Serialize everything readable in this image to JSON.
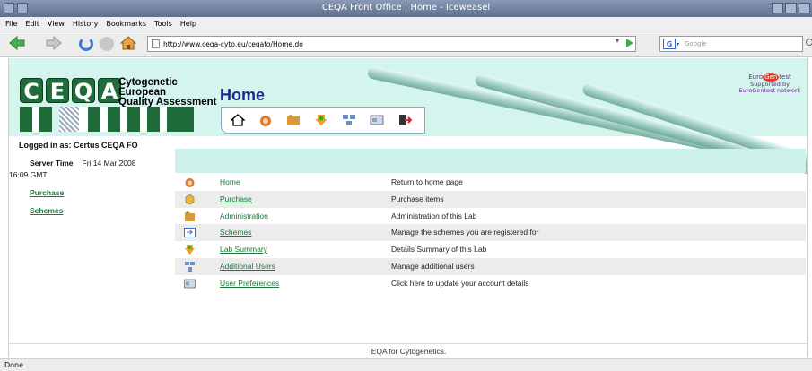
{
  "window": {
    "title": "CEQA Front Office | Home - Iceweasel"
  },
  "menu": [
    "File",
    "Edit",
    "View",
    "History",
    "Bookmarks",
    "Tools",
    "Help"
  ],
  "nav": {
    "url": "http://www.ceqa-cyto.eu/ceqafo/Home.do",
    "search_placeholder": "Google"
  },
  "logo": {
    "letters": [
      "C",
      "E",
      "Q",
      "A"
    ],
    "tagline_line1": "Cytogenetic European",
    "tagline_line2": "Quality Assessment"
  },
  "page_title": "Home",
  "toolbar_icons": [
    "home-icon",
    "purchase-icon",
    "administration-icon",
    "lab-summary-icon",
    "additional-users-icon",
    "user-preferences-icon",
    "logout-icon"
  ],
  "eurogentest": {
    "brand_pre": "Euro",
    "brand_mid": "Gen",
    "brand_post": "test",
    "line1": "Supported by",
    "line2": "EuroGentest network"
  },
  "sidebar": {
    "logged_in": "Logged in as: Certus CEQA FO",
    "server_time_label": "Server Time",
    "server_time_value": "Fri 14 Mar 2008",
    "server_time_cont": "16:09 GMT",
    "links": [
      "Purchase",
      "Schemes"
    ]
  },
  "menu_rows": [
    {
      "icon": "home-icon",
      "link": "Home",
      "desc": "Return to home page"
    },
    {
      "icon": "purchase-icon",
      "link": "Purchase",
      "desc": "Purchase items"
    },
    {
      "icon": "administration-icon",
      "link": "Administration",
      "desc": "Administration of this Lab"
    },
    {
      "icon": "schemes-icon",
      "link": "Schemes",
      "desc": "Manage the schemes you are registered for"
    },
    {
      "icon": "lab-summary-icon",
      "link": "Lab Summary",
      "desc": "Details Summary of this Lab"
    },
    {
      "icon": "additional-users-icon",
      "link": "Additional Users",
      "desc": "Manage additional users"
    },
    {
      "icon": "user-preferences-icon",
      "link": "User Preferences",
      "desc": "Click here to update your account details"
    }
  ],
  "footer": "EQA for Cytogenetics.",
  "status": "Done",
  "colors": {
    "header_bg": "#d4f4ee",
    "link": "#1a7a3a",
    "title": "#1a2a8a",
    "logo_green": "#1f6b3a"
  }
}
